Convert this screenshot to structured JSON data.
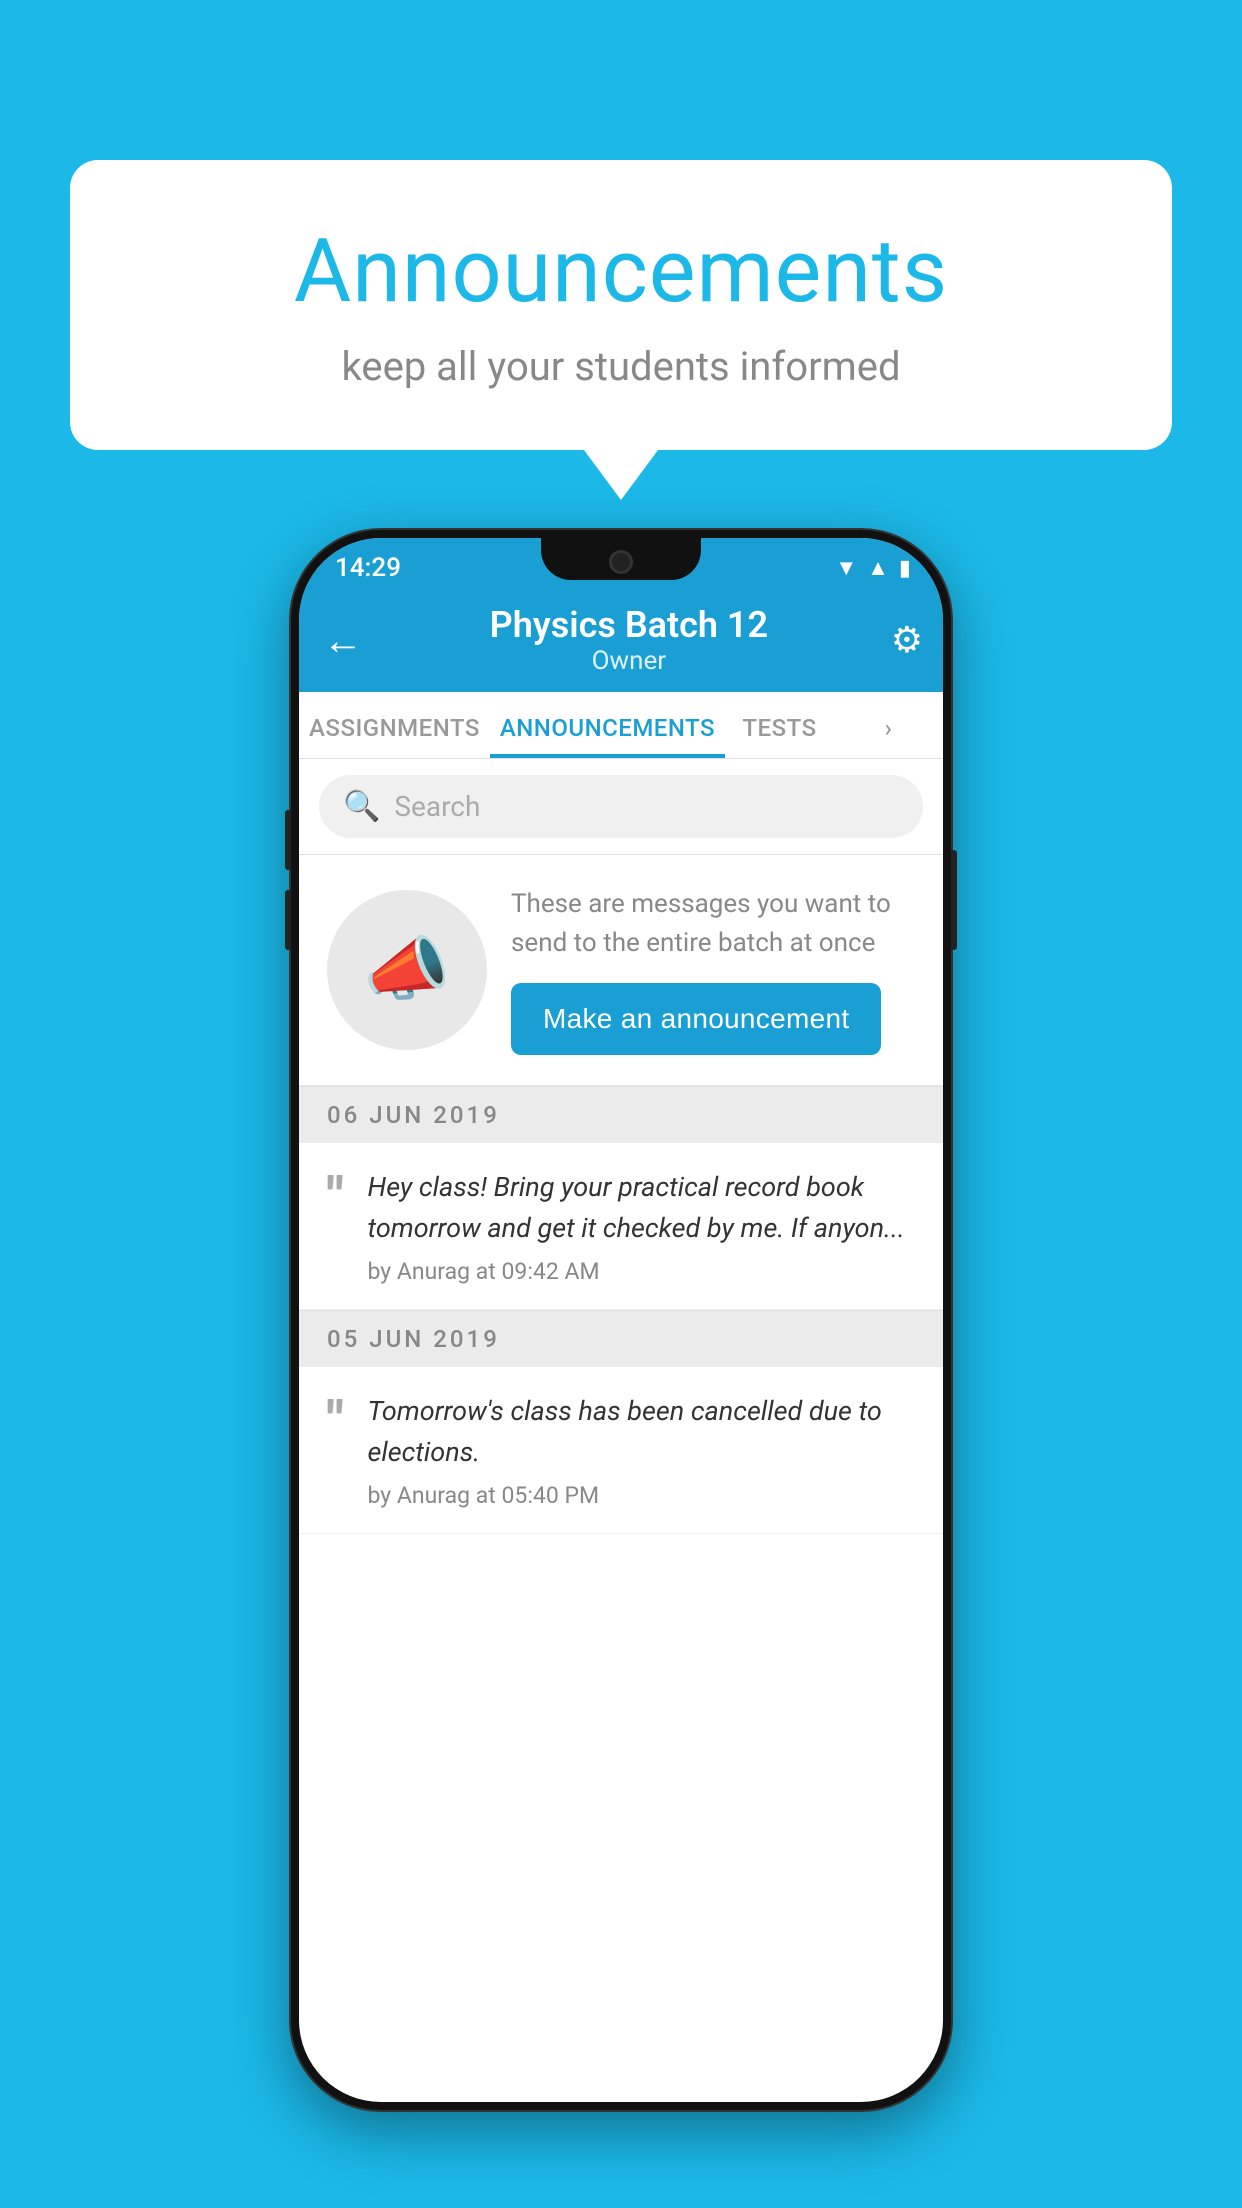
{
  "background": {
    "color": "#1bb8e8"
  },
  "speech_bubble": {
    "title": "Announcements",
    "subtitle": "keep all your students informed"
  },
  "phone": {
    "status_bar": {
      "time": "14:29",
      "icons": [
        "▼",
        "▲",
        "▮"
      ]
    },
    "header": {
      "back_label": "←",
      "title": "Physics Batch 12",
      "subtitle": "Owner",
      "gear_label": "⚙"
    },
    "tabs": [
      {
        "label": "ASSIGNMENTS",
        "active": false
      },
      {
        "label": "ANNOUNCEMENTS",
        "active": true
      },
      {
        "label": "TESTS",
        "active": false
      },
      {
        "label": "···",
        "active": false
      }
    ],
    "search": {
      "placeholder": "Search"
    },
    "promo": {
      "description": "These are messages you want to send to the entire batch at once",
      "button_label": "Make an announcement"
    },
    "announcements": [
      {
        "date": "06  JUN  2019",
        "messages": [
          {
            "text": "Hey class! Bring your practical record book tomorrow and get it checked by me. If anyon...",
            "meta": "by Anurag at 09:42 AM"
          }
        ]
      },
      {
        "date": "05  JUN  2019",
        "messages": [
          {
            "text": "Tomorrow's class has been cancelled due to elections.",
            "meta": "by Anurag at 05:40 PM"
          }
        ]
      }
    ]
  }
}
